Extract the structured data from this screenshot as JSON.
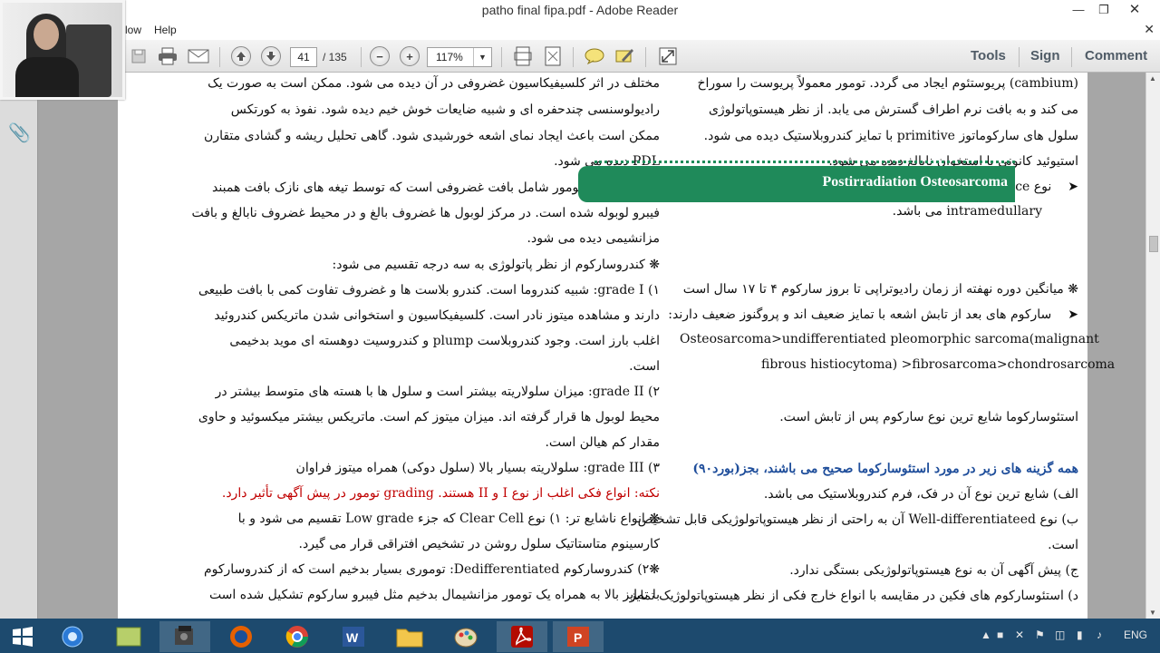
{
  "window": {
    "title": "patho final fipa.pdf - Adobe Reader"
  },
  "menu": {
    "items": [
      "low",
      "Help"
    ]
  },
  "toolbar": {
    "page_current": "41",
    "page_total": "/ 135",
    "zoom": "117%",
    "tools_label": "Tools",
    "sign_label": "Sign",
    "comment_label": "Comment"
  },
  "doc": {
    "left_lines": [
      "مختلف در اثر کلسیفیکاسیون غضروفی در آن دیده می شود. ممکن است به صورت یک",
      "رادیولوسنسی چندحفره ای و شبیه ضایعات خوش خیم دیده شود. نفوذ به کورتکس",
      "ممکن است باعث ایجاد نمای اشعه خورشیدی شود. گاهی تحلیل ریشه و گشادی متقارن",
      "PDL دیده می شود.",
      "میکروسکوپی: تومور شامل بافت غضروفی است که توسط تیغه های نازک بافت همبند",
      "فیبرو لوبوله شده است. در مرکز لوبول ها غضروف بالغ و در محیط غضروف نابالغ و بافت",
      "مزانشیمی دیده می شود.",
      "❋  کندروسارکوم از نظر پاتولوژی به سه درجه تقسیم می شود:",
      "۱) grade I: شبیه کندروما است. کندرو بلاست ها و غضروف تفاوت کمی با بافت طبیعی",
      "دارند و مشاهده میتوز نادر است. کلسیفیکاسیون و استخوانی شدن ماتریکس کندروئید",
      "اغلب بارز است. وجود کندروبلاست plump و کندروسیت دوهسته ای موید بدخیمی",
      "است.",
      "۲) grade II: میزان سلولاریته بیشتر است و سلول ها با هسته های متوسط بیشتر در",
      "محیط لوبول ها قرار گرفته اند. میزان میتوز کم است.  ماتریکس بیشتر میکسوئید و حاوی",
      "مقدار کم هیالن است.",
      "۳) grade III: سلولاریته بسیار بالا (سلول دوکی) همراه میتوز فراوان",
      "نکته: انواع فکی اغلب از نوع I و II هستند. grading تومور در پیش آگهی تأثیر دارد.",
      "❋  انواع ناشایع تر: ۱) نوع Clear Cell که جزء Low grade تقسیم می شود و با",
      "کارسینوم متاستاتیک سلول روشن در تشخیص افتراقی قرار می گیرد.",
      "❋۲) کندروسارکوم Dedifferentiated:  توموری بسیار بدخیم است که از کندروسارکوم",
      "با تمایز بالا به همراه یک تومور مزانشیمال بدخیم مثل فیبرو سارکوم تشکیل شده است"
    ],
    "right_top_lines": [
      "(cambium) پریوستئوم ایجاد می گردد. تومور معمولاً پریوست را سوراخ",
      "می کند و به بافت نرم اطراف گسترش می یابد. از نظر هیستوپاتولوژی",
      "سلول های سارکوماتوز primitive با تمایز کندروبلاستیک دیده می شود.",
      "استیوئید کانونی یا استخوان نابالغ دیده می شود.",
      "نوع High grade surface از نظر میکروسکوپی و رفتار بیولوژیک شبیه",
      "intramedullary می باشد."
    ],
    "section_title": "Postirradiation Osteosarcoma",
    "right_mid_lines": [
      "❋  میانگین دوره نهفته از زمان رادیوتراپی تا بروز سارکوم ۴ تا ۱۷ سال است",
      "سارکوم های بعد از تابش اشعه با تمایز ضعیف اند و پروگنوز ضعیف دارند:"
    ],
    "right_ltr_lines": [
      "Osteosarcoma>undifferentiated pleomorphic sarcoma(malignant",
      "fibrous histiocytoma) >fibrosarcoma>chondrosarcoma"
    ],
    "right_bottom_lines": [
      "استئوسارکوما شایع ترین نوع سارکوم پس از تابش است.",
      "همه گزینه های زیر در مورد استئوسارکوما صحیح می باشند، بجز(بورد۹۰)",
      "الف) شایع ترین نوع آن در فک، فرم کندروبلاستیک می باشد.",
      "ب) نوع Well-differentiateed آن به راحتی از نظر هیستوپاتولوژیکی قابل تشخیص",
      "است.",
      "ج) پیش آگهی آن به نوع هیستوپاتولوژیکی بستگی ندارد.",
      "د) استئوسارکوم های فکین در مقایسه با انواع خارج فکی از نظر هیستوپاتولوژیک تمایز"
    ]
  },
  "taskbar": {
    "lang": "ENG"
  },
  "colors": {
    "accent_green": "#1f8a5a",
    "question_blue": "#1f4e9b",
    "note_red": "#c00000",
    "taskbar": "#1d4a6e"
  }
}
